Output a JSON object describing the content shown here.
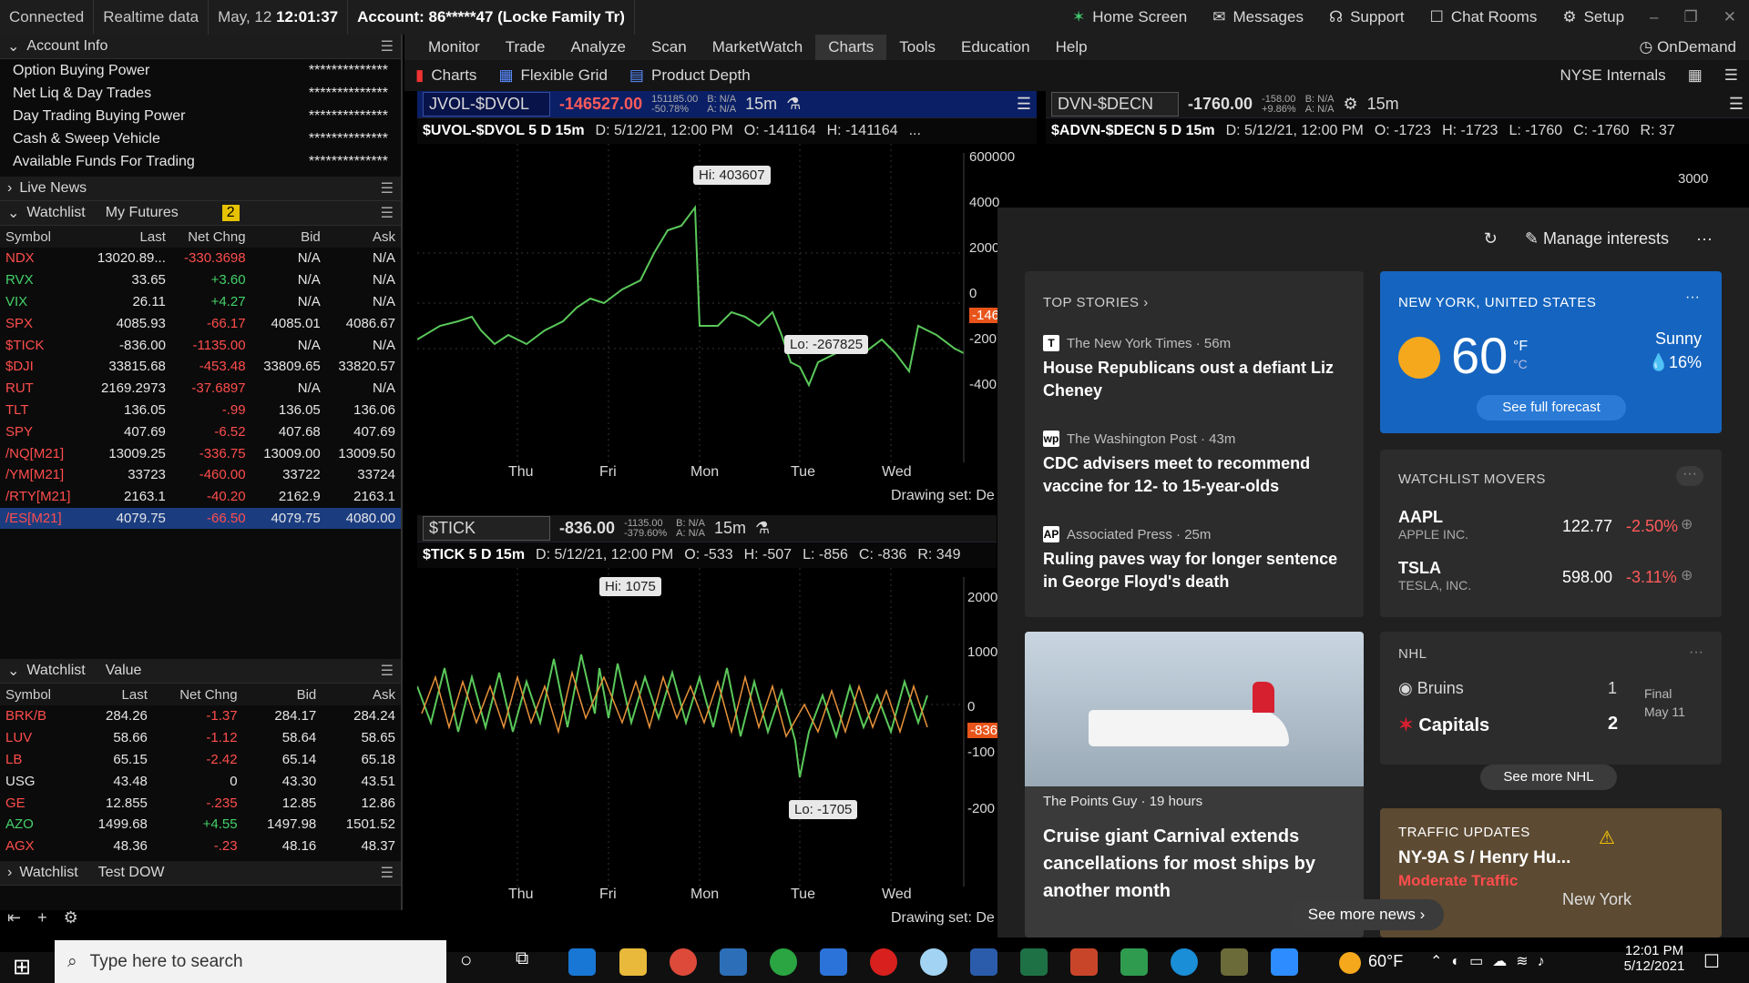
{
  "status": {
    "connected": "Connected",
    "realtime": "Realtime data",
    "date": "May, 12",
    "time": "12:01:37",
    "account": "Account: 86*****47 (Locke Family Tr)",
    "home": "Home Screen",
    "messages": "Messages",
    "support": "Support",
    "chat": "Chat Rooms",
    "setup": "Setup"
  },
  "account_info": {
    "title": "Account Info",
    "rows": [
      {
        "label": "Option Buying Power",
        "value": "**************"
      },
      {
        "label": "Net Liq & Day Trades",
        "value": "**************"
      },
      {
        "label": "Day Trading Buying Power",
        "value": "**************"
      },
      {
        "label": "Cash & Sweep Vehicle",
        "value": "**************"
      },
      {
        "label": "Available Funds For Trading",
        "value": "**************"
      }
    ]
  },
  "live_news": {
    "title": "Live News"
  },
  "watchlist1": {
    "title": "Watchlist",
    "name": "My Futures",
    "badge": "2",
    "columns": [
      "Symbol",
      "Last",
      "Net Chng",
      "Bid",
      "Ask"
    ],
    "rows": [
      [
        "NDX",
        "13020.89...",
        "-330.3698",
        "N/A",
        "N/A"
      ],
      [
        "RVX",
        "33.65",
        "+3.60",
        "N/A",
        "N/A"
      ],
      [
        "VIX",
        "26.11",
        "+4.27",
        "N/A",
        "N/A"
      ],
      [
        "SPX",
        "4085.93",
        "-66.17",
        "4085.01",
        "4086.67"
      ],
      [
        "$TICK",
        "-836.00",
        "-1135.00",
        "N/A",
        "N/A"
      ],
      [
        "$DJI",
        "33815.68",
        "-453.48",
        "33809.65",
        "33820.57"
      ],
      [
        "RUT",
        "2169.2973",
        "-37.6897",
        "N/A",
        "N/A"
      ],
      [
        "TLT",
        "136.05",
        "-.99",
        "136.05",
        "136.06"
      ],
      [
        "SPY",
        "407.69",
        "-6.52",
        "407.68",
        "407.69"
      ],
      [
        "/NQ[M21]",
        "13009.25",
        "-336.75",
        "13009.00",
        "13009.50"
      ],
      [
        "/YM[M21]",
        "33723",
        "-460.00",
        "33722",
        "33724"
      ],
      [
        "/RTY[M21]",
        "2163.1",
        "-40.20",
        "2162.9",
        "2163.1"
      ],
      [
        "/ES[M21]",
        "4079.75",
        "-66.50",
        "4079.75",
        "4080.00"
      ]
    ]
  },
  "watchlist2": {
    "title": "Watchlist",
    "name": "Value",
    "columns": [
      "Symbol",
      "Last",
      "Net Chng",
      "Bid",
      "Ask"
    ],
    "rows": [
      [
        "BRK/B",
        "284.26",
        "-1.37",
        "284.17",
        "284.24"
      ],
      [
        "LUV",
        "58.66",
        "-1.12",
        "58.64",
        "58.65"
      ],
      [
        "LB",
        "65.15",
        "-2.42",
        "65.14",
        "65.18"
      ],
      [
        "USG",
        "43.48",
        "0",
        "43.30",
        "43.51"
      ],
      [
        "GE",
        "12.855",
        "-.235",
        "12.85",
        "12.86"
      ],
      [
        "AZO",
        "1499.68",
        "+4.55",
        "1497.98",
        "1501.52"
      ],
      [
        "AGX",
        "48.36",
        "-.23",
        "48.16",
        "48.37"
      ]
    ]
  },
  "watchlist3": {
    "title": "Watchlist",
    "name": "Test DOW"
  },
  "menu": [
    "Monitor",
    "Trade",
    "Analyze",
    "Scan",
    "MarketWatch",
    "Charts",
    "Tools",
    "Education",
    "Help"
  ],
  "ondemand": "OnDemand",
  "subtabs": [
    "Charts",
    "Flexible Grid",
    "Product Depth"
  ],
  "nyse": "NYSE Internals",
  "chart1": {
    "symbol": "JVOL-$DVOL",
    "value": "-146527.00",
    "tiny1": "151185.00",
    "tiny2": "-50.78%",
    "ba1": "B: N/A",
    "ba2": "A: N/A",
    "tf": "15m",
    "info_title": "$UVOL-$DVOL 5 D 15m",
    "info_d": "D: 5/12/21, 12:00 PM",
    "info_o": "O: -141164",
    "info_h": "H: -141164",
    "info_more": "...",
    "hi": "Hi: 403607",
    "lo": "Lo: -267825",
    "yticks": [
      "600000",
      "4000",
      "2000",
      "0",
      "-200",
      "-400"
    ],
    "last_tag": "-146",
    "days": [
      "Thu",
      "Fri",
      "Mon",
      "Tue",
      "Wed"
    ],
    "drawing": "Drawing set: De"
  },
  "chart2": {
    "symbol": "DVN-$DECN",
    "value": "-1760.00",
    "tiny1": "-158.00",
    "tiny2": "+9.86%",
    "ba1": "B: N/A",
    "ba2": "A: N/A",
    "tf": "15m",
    "info_title": "$ADVN-$DECN 5 D 15m",
    "info_d": "D: 5/12/21, 12:00 PM",
    "info_o": "O: -1723",
    "info_h": "H: -1723",
    "info_l": "L: -1760",
    "info_c": "C: -1760",
    "info_r": "R: 37",
    "ytick": "3000"
  },
  "chart3": {
    "symbol": "$TICK",
    "value": "-836.00",
    "tiny1": "-1135.00",
    "tiny2": "-379.60%",
    "ba1": "B: N/A",
    "ba2": "A: N/A",
    "tf": "15m",
    "info_title": "$TICK 5 D 15m",
    "info_d": "D: 5/12/21, 12:00 PM",
    "info_o": "O: -533",
    "info_h": "H: -507",
    "info_l": "L: -856",
    "info_c": "C: -836",
    "info_r": "R: 349",
    "hi": "Hi: 1075",
    "lo": "Lo: -1705",
    "yticks": [
      "2000",
      "1000",
      "0",
      "-100",
      "-200"
    ],
    "last_tag": "-836",
    "days": [
      "Thu",
      "Fri",
      "Mon",
      "Tue",
      "Wed"
    ],
    "drawing": "Drawing set: De"
  },
  "news": {
    "manage": "Manage interests",
    "top_stories": "TOP STORIES",
    "stories": [
      {
        "source": "The New York Times · 56m",
        "icon": "T",
        "headline": "House Republicans oust a defiant Liz Cheney"
      },
      {
        "source": "The Washington Post · 43m",
        "icon": "wp",
        "headline": "CDC advisers meet to recommend vaccine for 12- to 15-year-olds"
      },
      {
        "source": "Associated Press · 25m",
        "icon": "AP",
        "headline": "Ruling paves way for longer sentence in George Floyd's death"
      }
    ],
    "weather": {
      "location": "NEW YORK, UNITED STATES",
      "temp": "60",
      "unit_f": "°F",
      "unit_c": "°C",
      "cond": "Sunny",
      "precip": "16%",
      "forecast": "See full forecast"
    },
    "movers": {
      "title": "WATCHLIST MOVERS",
      "items": [
        {
          "sym": "AAPL",
          "name": "APPLE INC.",
          "price": "122.77",
          "chg": "-2.50%"
        },
        {
          "sym": "TSLA",
          "name": "TESLA, INC.",
          "price": "598.00",
          "chg": "-3.11%"
        }
      ]
    },
    "photo_story": {
      "source": "The Points Guy · 19 hours",
      "headline": "Cruise giant Carnival extends cancellations for most ships by another month"
    },
    "nhl": {
      "title": "NHL",
      "team1": "Bruins",
      "score1": "1",
      "team2": "Capitals",
      "score2": "2",
      "final": "Final",
      "date": "May 11",
      "more": "See more NHL"
    },
    "traffic": {
      "title": "TRAFFIC UPDATES",
      "road": "NY-9A S / Henry Hu...",
      "status": "Moderate Traffic",
      "map_label": "New York"
    },
    "see_more": "See more news"
  },
  "taskbar": {
    "search": "Type here to search",
    "weather": "60°F",
    "time": "12:01 PM",
    "date": "5/12/2021"
  }
}
